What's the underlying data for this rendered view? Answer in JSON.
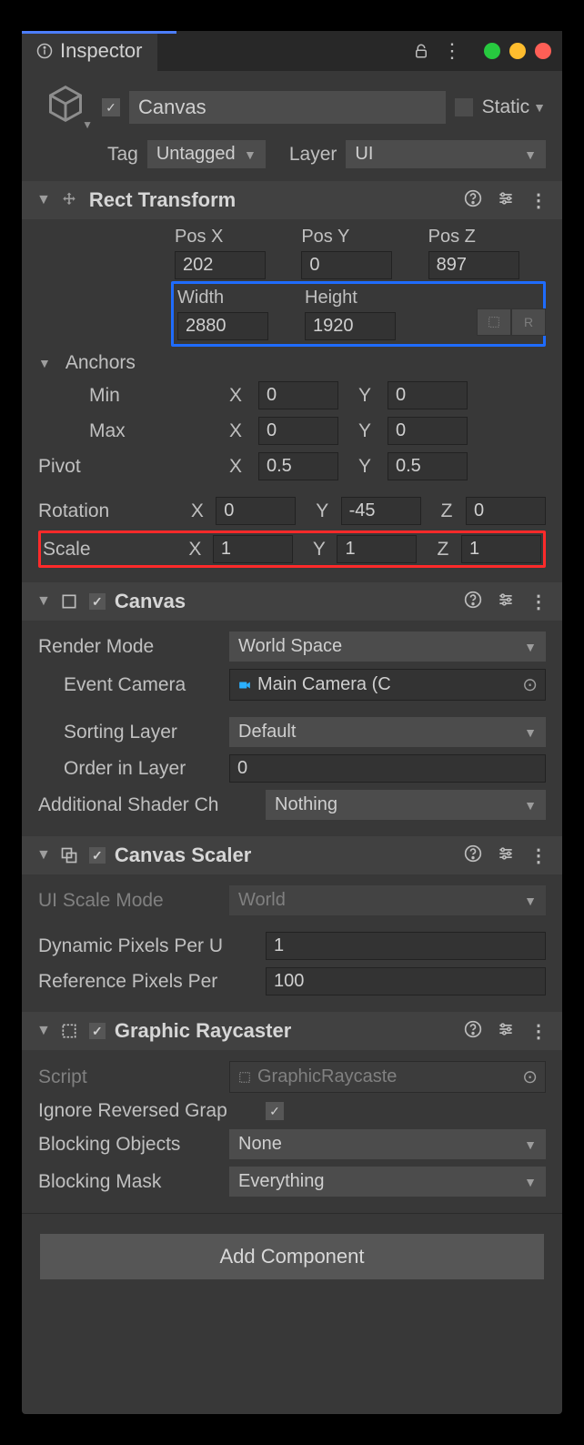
{
  "tab": {
    "title": "Inspector"
  },
  "window_dots": [
    "green",
    "yellow",
    "red"
  ],
  "header": {
    "enabled": true,
    "name": "Canvas",
    "static_label": "Static",
    "tag_label": "Tag",
    "tag_value": "Untagged",
    "layer_label": "Layer",
    "layer_value": "UI"
  },
  "rect_transform": {
    "title": "Rect Transform",
    "pos_x_label": "Pos X",
    "pos_y_label": "Pos Y",
    "pos_z_label": "Pos Z",
    "pos_x": "202",
    "pos_y": "0",
    "pos_z": "897",
    "width_label": "Width",
    "height_label": "Height",
    "width": "2880",
    "height": "1920",
    "blueprint_btn": "⠿",
    "raw_btn": "R",
    "anchors_label": "Anchors",
    "min_label": "Min",
    "min_x": "0",
    "min_y": "0",
    "max_label": "Max",
    "max_x": "0",
    "max_y": "0",
    "pivot_label": "Pivot",
    "pivot_x": "0.5",
    "pivot_y": "0.5",
    "rotation_label": "Rotation",
    "rot_x": "0",
    "rot_y": "-45",
    "rot_z": "0",
    "scale_label": "Scale",
    "scale_x": "1",
    "scale_y": "1",
    "scale_z": "1"
  },
  "canvas": {
    "title": "Canvas",
    "enabled": true,
    "render_mode_label": "Render Mode",
    "render_mode": "World Space",
    "event_camera_label": "Event Camera",
    "event_camera": "Main Camera (C",
    "sorting_layer_label": "Sorting Layer",
    "sorting_layer": "Default",
    "order_label": "Order in Layer",
    "order": "0",
    "addl_shader_label": "Additional Shader Ch",
    "addl_shader": "Nothing"
  },
  "canvas_scaler": {
    "title": "Canvas Scaler",
    "enabled": true,
    "ui_scale_mode_label": "UI Scale Mode",
    "ui_scale_mode": "World",
    "dyn_px_label": "Dynamic Pixels Per U",
    "dyn_px": "1",
    "ref_px_label": "Reference Pixels Per",
    "ref_px": "100"
  },
  "graphic_raycaster": {
    "title": "Graphic Raycaster",
    "enabled": true,
    "script_label": "Script",
    "script_value": "GraphicRaycaste",
    "ignore_rev_label": "Ignore Reversed Grap",
    "ignore_rev": true,
    "blocking_objects_label": "Blocking Objects",
    "blocking_objects": "None",
    "blocking_mask_label": "Blocking Mask",
    "blocking_mask": "Everything"
  },
  "add_component": "Add Component"
}
